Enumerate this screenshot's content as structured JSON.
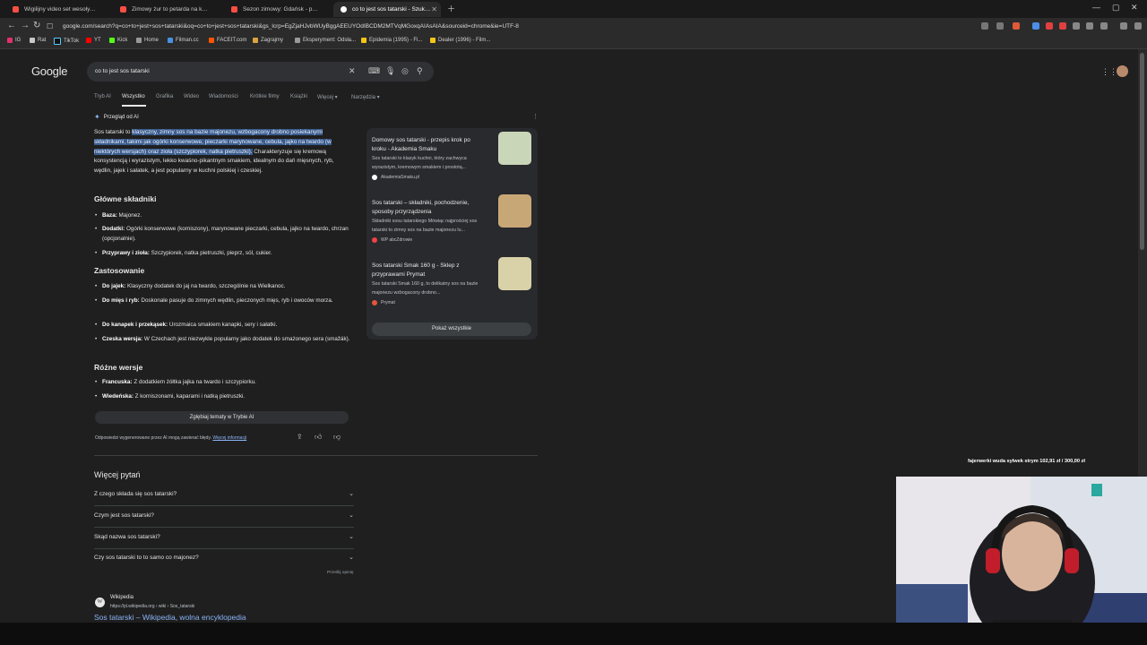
{
  "tabs": [
    {
      "title": "Wigilijny video set wesołych świąt ko",
      "active": false,
      "color": "#ff4e45"
    },
    {
      "title": "Zimowy żur to petarda na każdy dzień",
      "active": false,
      "color": "#ff4e45"
    },
    {
      "title": "Sezon zimowy: Gdańsk - ponoć najle",
      "active": false,
      "color": "#ff4e45"
    },
    {
      "title": "co to jest sos tatarski - Szukaj w G",
      "active": true,
      "color": "#ffffff"
    }
  ],
  "url": "google.com/search?q=co+to+jest+sos+tatarski&oq=co+to+jest+sos+tatarski&gs_lcrp=EgZjaHJvbWUyBggAEEUYOdIBCDM2MTVqMGoxqAIAsAIA&sourceid=chrome&ie=UTF-8",
  "bookmarks": [
    "IG",
    "Rat",
    "TikTok",
    "YT",
    "Kick",
    "Home",
    "Filman.cc",
    "FACEIT.com",
    "Zagrajmy",
    "Eksperyment: Odsła...",
    "Epidemia (1995) - Fi...",
    "Dealer (1996) - Film..."
  ],
  "google": {
    "logo": "Google",
    "query": "co to jest sos tatarski"
  },
  "search_tabs": [
    "Tryb AI",
    "Wszystko",
    "Grafika",
    "Wideo",
    "Wiadomości",
    "Krótkie filmy",
    "Książki",
    "Więcej ▾",
    "Narzędzia ▾"
  ],
  "ai": {
    "header": "Przegląd od AI",
    "intro_plain": "Sos tatarski to ",
    "intro_highlight": "klasyczny, zimny sos na bazie majonezu, wzbogacony drobno posiekanymi składnikami, takimi jak ogórki konserwowe, pieczarki marynowane, cebula, jajko na twardo (w niektórych wersjach) oraz zioła (szczypiorek, natka pietruszki).",
    "intro_rest": " Charakteryzuje się kremową konsystencją i wyrazistym, lekko kwaśno-pikantnym smakiem, idealnym do dań mięsnych, ryb, wędlin, jajek i sałatek, a jest popularny w kuchni polskiej i czeskiej.",
    "h1": "Główne składniki",
    "s1": [
      {
        "label": "Baza:",
        "text": " Majonez."
      },
      {
        "label": "Dodatki:",
        "text": " Ogórki konserwowe (korniszony), marynowane pieczarki, cebula, jajko na twardo, chrzan (opcjonalnie)."
      },
      {
        "label": "Przyprawy i zioła:",
        "text": " Szczypiorek, natka pietruszki, pieprz, sól, cukier."
      }
    ],
    "h2": "Zastosowanie",
    "s2": [
      {
        "label": "Do jajek:",
        "text": " Klasyczny dodatek do jaj na twardo, szczególnie na Wielkanoc."
      },
      {
        "label": "Do mięs i ryb:",
        "text": " Doskonale pasuje do zimnych wędlin, pieczonych mięs, ryb i owoców morza."
      },
      {
        "label": "Do kanapek i przekąsek:",
        "text": " Urozmaica smakiem kanapki, sery i sałatki."
      },
      {
        "label": "Czeska wersja:",
        "text": " W Czechach jest niezwykle popularny jako dodatek do smażonego sera (smažák)."
      }
    ],
    "h3": "Różne wersje",
    "s3": [
      {
        "label": "Francuska:",
        "text": " Z dodatkiem żółtka jajka na twardo i szczypiorku."
      },
      {
        "label": "Wiedeńska:",
        "text": " Z korniszonami, kaparami i natką pietruszki."
      }
    ],
    "deep_button": "Zgłębiaj tematy w Trybie AI",
    "disclaimer": "Odpowiedzi wygenerowane przez AI mogą zawierać błędy.",
    "disclaimer_link": "Więcej informacji"
  },
  "sources": [
    {
      "title": "Domowy sos tatarski - przepis krok po kroku - Akademia Smaku",
      "desc": "Sos tatarski to klasyk kuchni, który zachwyca wyrazistym, kremowym smakiem i prostotą...",
      "site": "AkademiaSmaku.pl",
      "thumb": "#c9d6b8"
    },
    {
      "title": "Sos tatarski – składniki, pochodzenie, sposoby przyrządzenia",
      "desc": "Składniki sosu tatarskiego Mówiąc najprościej sos tatarski to zimny sos na bazie majonezu lu...",
      "site": "WP abcZdrowie",
      "thumb": "#c8a777"
    },
    {
      "title": "Sos tatarski Smak 160 g - Sklep z przyprawami Prymat",
      "desc": "Sos tatarski Smak 160 g, to delikatny sos na bazie majonezu wzbogacony drobno...",
      "site": "Prymat",
      "thumb": "#d9d2a8"
    }
  ],
  "show_all": "Pokaż wszystkie",
  "paa": {
    "header": "Więcej pytań",
    "questions": [
      "Z czego składa się sos tatarski?",
      "Czym jest sos tatarski?",
      "Skąd nazwa sos tatarski?",
      "Czy sos tatarski to to samo co majonez?"
    ],
    "feedback": "Prześlij opinię"
  },
  "wiki": {
    "name": "Wikipedia",
    "url": "https://pl.wikipedia.org › wiki › Sos_tatarski",
    "title": "Sos tatarski – Wikipedia, wolna encyklopedia"
  },
  "ticker": "fajerwerki wuda sylwek strym  102,91 zł  /  300,00 zł"
}
